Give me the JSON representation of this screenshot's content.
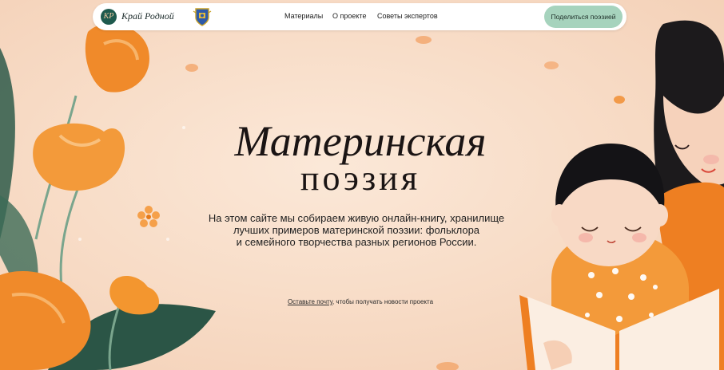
{
  "colors": {
    "accent_button": "#a6d3bd",
    "flower_orange": "#f08a2a",
    "leaf_green": "#2e5a4a",
    "background_peach": "#f8ddc8"
  },
  "header": {
    "logo_mark": "КР",
    "brand_name": "Край Родной",
    "crest_icon": "coat-of-arms-icon",
    "nav": [
      {
        "label": "Материалы"
      },
      {
        "label": "О проекте"
      },
      {
        "label": "Советы экспертов"
      }
    ],
    "cta_label": "Поделиться поэзией"
  },
  "hero": {
    "title_line1": "Материнская",
    "title_line2": "поэзия",
    "description_lines": [
      "На этом сайте мы собираем живую онлайн-книгу, хранилище",
      "лучших примеров материнской поэзии: фольклора",
      "и семейного творчества разных регионов России."
    ],
    "subscribe_link": "Оставьте почту",
    "subscribe_rest": ", чтобы получать новости проекта"
  }
}
